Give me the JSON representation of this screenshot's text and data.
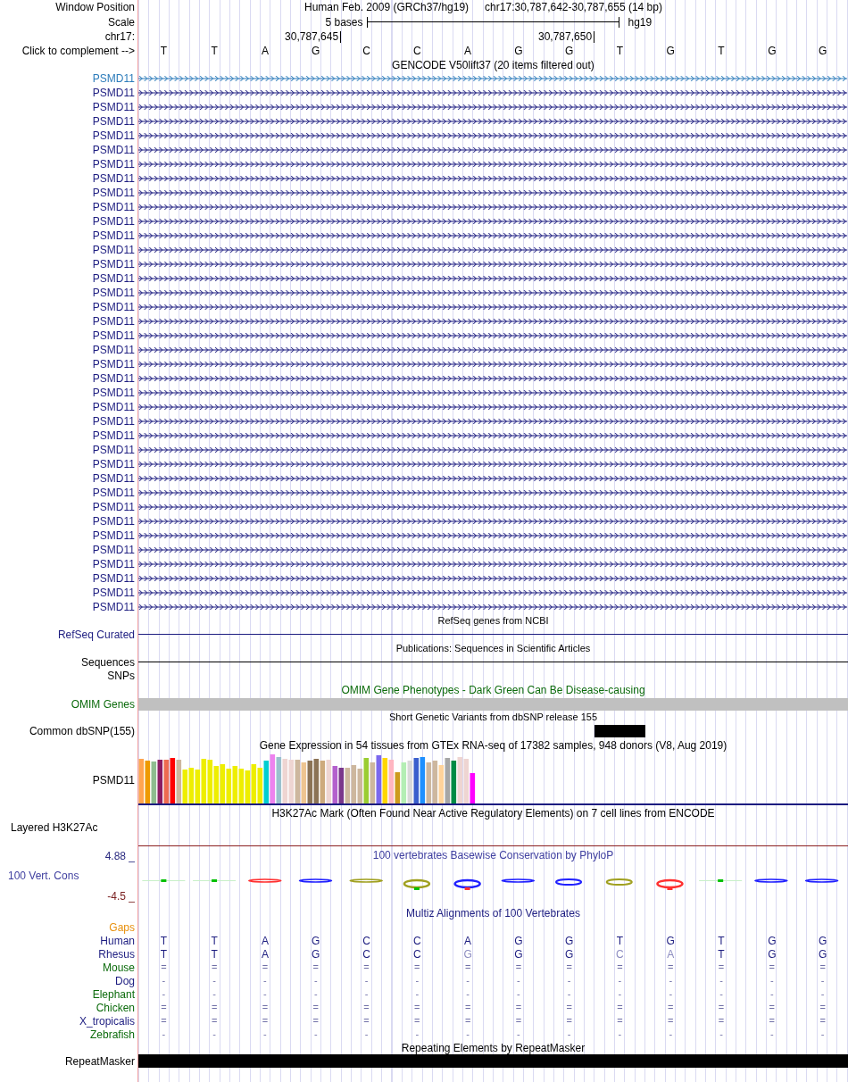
{
  "header": {
    "window_position_label": "Window Position",
    "assembly": "Human Feb. 2009 (GRCh37/hg19)",
    "position": "chr17:30,787,642-30,787,655 (14 bp)",
    "scale_label": "Scale",
    "scale_text": "5 bases",
    "scale_db": "hg19",
    "chrom_label": "chr17:",
    "ticks": [
      "30,787,645",
      "30,787,650"
    ],
    "complement_label": "Click to complement -->",
    "bases": [
      "T",
      "T",
      "A",
      "G",
      "C",
      "C",
      "A",
      "G",
      "G",
      "T",
      "G",
      "T",
      "G",
      "G"
    ]
  },
  "gencode": {
    "title": "GENCODE V50lift37 (20 items filtered out)",
    "items": [
      {
        "label": "PSMD11",
        "color": "#2b7bba"
      },
      {
        "label": "PSMD11",
        "color": "#1c1c80"
      },
      {
        "label": "PSMD11",
        "color": "#1c1c80"
      },
      {
        "label": "PSMD11",
        "color": "#1c1c80"
      },
      {
        "label": "PSMD11",
        "color": "#1c1c80"
      },
      {
        "label": "PSMD11",
        "color": "#1c1c80"
      },
      {
        "label": "PSMD11",
        "color": "#1c1c80"
      },
      {
        "label": "PSMD11",
        "color": "#1c1c80"
      },
      {
        "label": "PSMD11",
        "color": "#1c1c80"
      },
      {
        "label": "PSMD11",
        "color": "#1c1c80"
      },
      {
        "label": "PSMD11",
        "color": "#1c1c80"
      },
      {
        "label": "PSMD11",
        "color": "#1c1c80"
      },
      {
        "label": "PSMD11",
        "color": "#1c1c80"
      },
      {
        "label": "PSMD11",
        "color": "#1c1c80"
      },
      {
        "label": "PSMD11",
        "color": "#1c1c80"
      },
      {
        "label": "PSMD11",
        "color": "#1c1c80"
      },
      {
        "label": "PSMD11",
        "color": "#1c1c80"
      },
      {
        "label": "PSMD11",
        "color": "#1c1c80"
      },
      {
        "label": "PSMD11",
        "color": "#1c1c80"
      },
      {
        "label": "PSMD11",
        "color": "#1c1c80"
      },
      {
        "label": "PSMD11",
        "color": "#1c1c80"
      },
      {
        "label": "PSMD11",
        "color": "#1c1c80"
      },
      {
        "label": "PSMD11",
        "color": "#1c1c80"
      },
      {
        "label": "PSMD11",
        "color": "#1c1c80"
      },
      {
        "label": "PSMD11",
        "color": "#1c1c80"
      },
      {
        "label": "PSMD11",
        "color": "#1c1c80"
      },
      {
        "label": "PSMD11",
        "color": "#1c1c80"
      },
      {
        "label": "PSMD11",
        "color": "#1c1c80"
      },
      {
        "label": "PSMD11",
        "color": "#1c1c80"
      },
      {
        "label": "PSMD11",
        "color": "#1c1c80"
      },
      {
        "label": "PSMD11",
        "color": "#1c1c80"
      },
      {
        "label": "PSMD11",
        "color": "#1c1c80"
      },
      {
        "label": "PSMD11",
        "color": "#1c1c80"
      },
      {
        "label": "PSMD11",
        "color": "#1c1c80"
      },
      {
        "label": "PSMD11",
        "color": "#1c1c80"
      },
      {
        "label": "PSMD11",
        "color": "#1c1c80"
      },
      {
        "label": "PSMD11",
        "color": "#1c1c80"
      },
      {
        "label": "PSMD11",
        "color": "#1c1c80"
      }
    ]
  },
  "refseq": {
    "title": "RefSeq genes from NCBI",
    "label": "RefSeq Curated"
  },
  "publications": {
    "title": "Publications: Sequences in Scientific Articles",
    "labels": [
      "Sequences",
      "SNPs"
    ]
  },
  "omim": {
    "title": "OMIM Gene Phenotypes - Dark Green Can Be Disease-causing",
    "label": "OMIM Genes"
  },
  "dbsnp": {
    "title": "Short Genetic Variants from dbSNP release 155",
    "label": "Common dbSNP(155)"
  },
  "gtex": {
    "title": "Gene Expression in 54 tissues from GTEx RNA-seq of 17382 samples, 948 donors (V8, Aug 2019)",
    "label": "PSMD11"
  },
  "h3k27ac": {
    "title": "H3K27Ac Mark (Often Found Near Active Regulatory Elements) on 7 cell lines from ENCODE",
    "label": "Layered H3K27Ac"
  },
  "phylop": {
    "title": "100 vertebrates Basewise Conservation by PhyloP",
    "label": "100 Vert. Cons",
    "max": "4.88 _",
    "min": "-4.5 _"
  },
  "multiz": {
    "title": "Multiz Alignments of 100 Vertebrates",
    "species": [
      {
        "name": "Gaps",
        "color": "#e8900c"
      },
      {
        "name": "Human",
        "color": "#1c1c80",
        "kind": "sequence",
        "bases": [
          {
            "base": "T",
            "differs": false
          },
          {
            "base": "T",
            "differs": false
          },
          {
            "base": "A",
            "differs": false
          },
          {
            "base": "G",
            "differs": false
          },
          {
            "base": "C",
            "differs": false
          },
          {
            "base": "C",
            "differs": false
          },
          {
            "base": "A",
            "differs": false
          },
          {
            "base": "G",
            "differs": false
          },
          {
            "base": "G",
            "differs": false
          },
          {
            "base": "T",
            "differs": false
          },
          {
            "base": "G",
            "differs": false
          },
          {
            "base": "T",
            "differs": false
          },
          {
            "base": "G",
            "differs": false
          },
          {
            "base": "G",
            "differs": false
          }
        ]
      },
      {
        "name": "Rhesus",
        "color": "#1c1c80",
        "kind": "sequence",
        "bases": [
          {
            "base": "T",
            "differs": false
          },
          {
            "base": "T",
            "differs": false
          },
          {
            "base": "A",
            "differs": false
          },
          {
            "base": "G",
            "differs": false
          },
          {
            "base": "C",
            "differs": false
          },
          {
            "base": "C",
            "differs": false
          },
          {
            "base": "G",
            "differs": true
          },
          {
            "base": "G",
            "differs": false
          },
          {
            "base": "G",
            "differs": false
          },
          {
            "base": "C",
            "differs": true
          },
          {
            "base": "A",
            "differs": true
          },
          {
            "base": "T",
            "differs": false
          },
          {
            "base": "G",
            "differs": false
          },
          {
            "base": "G",
            "differs": false
          }
        ]
      },
      {
        "name": "Mouse",
        "color": "#0c6b0c",
        "kind": "summary",
        "bases": [
          "=",
          "=",
          "=",
          "=",
          "=",
          "=",
          "=",
          "=",
          "=",
          "=",
          "=",
          "=",
          "=",
          "="
        ]
      },
      {
        "name": "Dog",
        "color": "#1c1c80",
        "kind": "summary",
        "bases": [
          "-",
          "-",
          "-",
          "-",
          "-",
          "-",
          "-",
          "-",
          "-",
          "-",
          "-",
          "-",
          "-",
          "-"
        ]
      },
      {
        "name": "Elephant",
        "color": "#0c6b0c",
        "kind": "summary",
        "bases": [
          "-",
          "-",
          "-",
          "-",
          "-",
          "-",
          "-",
          "-",
          "-",
          "-",
          "-",
          "-",
          "-",
          "-"
        ]
      },
      {
        "name": "Chicken",
        "color": "#0c6b0c",
        "kind": "summary",
        "bases": [
          "=",
          "=",
          "=",
          "=",
          "=",
          "=",
          "=",
          "=",
          "=",
          "=",
          "=",
          "=",
          "=",
          "="
        ]
      },
      {
        "name": "X_tropicalis",
        "color": "#1c1c80",
        "kind": "summary",
        "bases": [
          "=",
          "=",
          "=",
          "=",
          "=",
          "=",
          "=",
          "=",
          "=",
          "=",
          "=",
          "=",
          "=",
          "="
        ]
      },
      {
        "name": "Zebrafish",
        "color": "#0c6b0c",
        "kind": "summary",
        "bases": [
          "-",
          "-",
          "-",
          "-",
          "-",
          "-",
          "-",
          "-",
          "-",
          "-",
          "-",
          "-",
          "-",
          "-"
        ]
      }
    ]
  },
  "repeatmasker": {
    "title": "Repeating Elements by RepeatMasker",
    "label": "RepeatMasker"
  }
}
